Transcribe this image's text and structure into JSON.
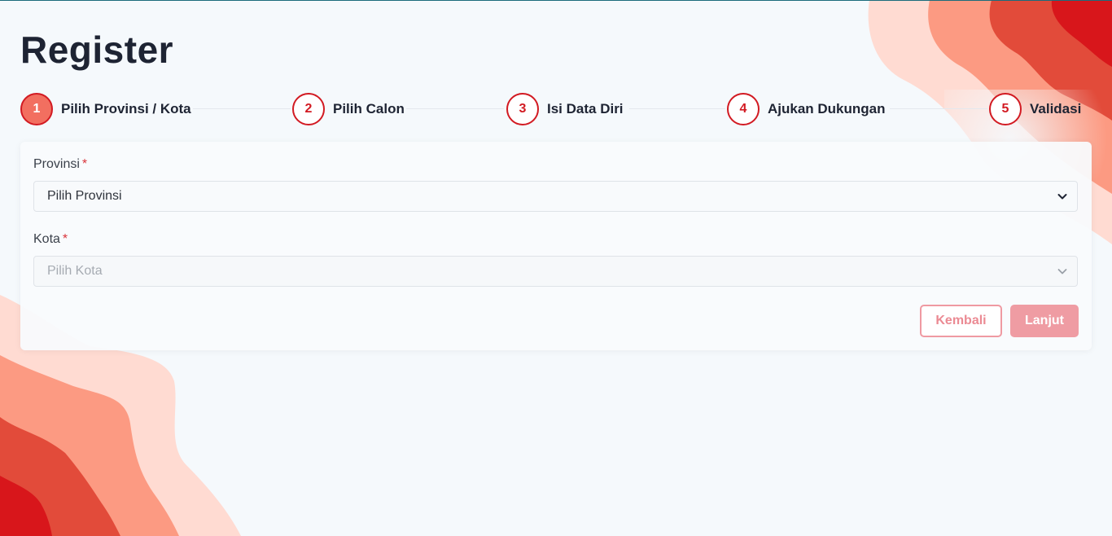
{
  "page": {
    "title": "Register"
  },
  "stepper": {
    "active_step": 1,
    "steps": [
      {
        "number": "1",
        "label": "Pilih Provinsi / Kota"
      },
      {
        "number": "2",
        "label": "Pilih Calon"
      },
      {
        "number": "3",
        "label": "Isi Data Diri"
      },
      {
        "number": "4",
        "label": "Ajukan Dukungan"
      },
      {
        "number": "5",
        "label": "Validasi"
      }
    ]
  },
  "form": {
    "province": {
      "label": "Provinsi",
      "required_mark": "*",
      "selected": "Pilih Provinsi"
    },
    "city": {
      "label": "Kota",
      "required_mark": "*",
      "selected": "Pilih Kota",
      "disabled": true
    }
  },
  "actions": {
    "back_label": "Kembali",
    "next_label": "Lanjut"
  },
  "colors": {
    "accent": "#d21a22",
    "active_step": "#f26f60",
    "button_disabled": "#ef9ca3",
    "wave_light": "#ffdbd2",
    "wave_mid": "#fc9a82",
    "wave_dark": "#e24b3a",
    "wave_deep": "#d8161b"
  },
  "icons": {
    "select_arrow": "chevron-down-icon"
  }
}
